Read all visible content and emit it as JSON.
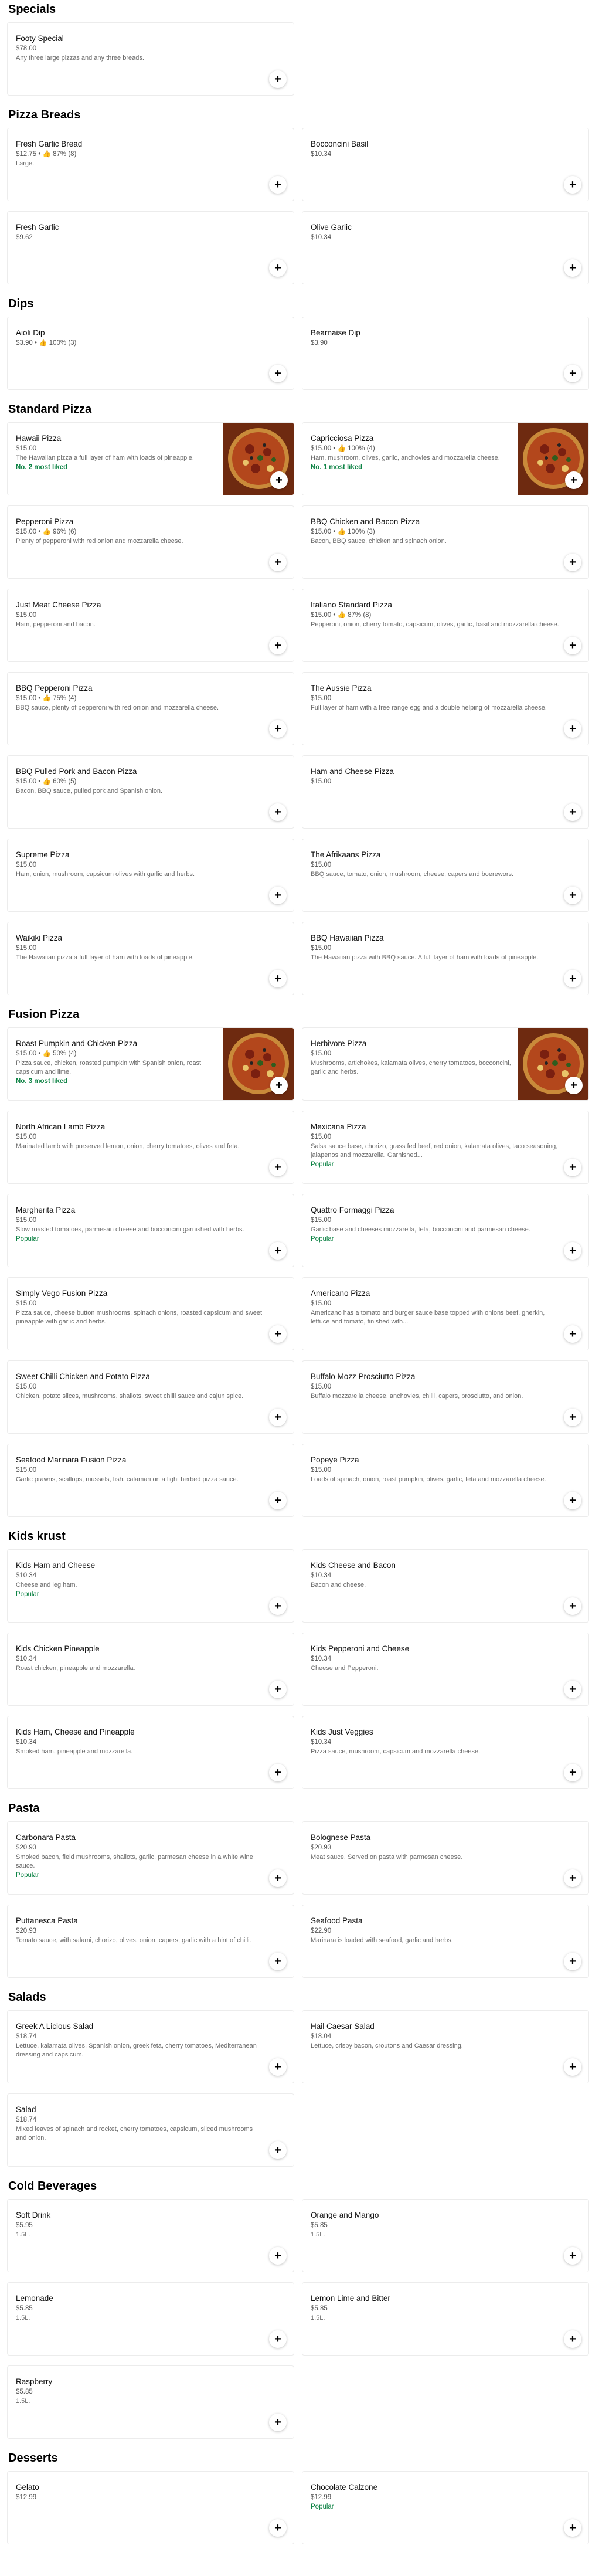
{
  "add_label": "+",
  "sections": [
    {
      "title": "Specials",
      "items": [
        {
          "name": "Footy Special",
          "meta": "$78.00",
          "desc": "Any three large pizzas and any three breads."
        }
      ]
    },
    {
      "title": "Pizza Breads",
      "items": [
        {
          "name": "Fresh Garlic Bread",
          "meta": "$12.75 • 👍 87% (8)",
          "desc": "Large."
        },
        {
          "name": "Bocconcini Basil",
          "meta": "$10.34",
          "desc": ""
        },
        {
          "name": "Fresh Garlic",
          "meta": "$9.62",
          "desc": ""
        },
        {
          "name": "Olive Garlic",
          "meta": "$10.34",
          "desc": ""
        }
      ]
    },
    {
      "title": "Dips",
      "items": [
        {
          "name": "Aioli Dip",
          "meta": "$3.90 • 👍 100% (3)",
          "desc": ""
        },
        {
          "name": "Bearnaise Dip",
          "meta": "$3.90",
          "desc": ""
        }
      ]
    },
    {
      "title": "Standard Pizza",
      "items": [
        {
          "name": "Hawaii Pizza",
          "meta": "$15.00",
          "desc": "The Hawaiian pizza a full layer of ham with loads of pineapple.",
          "tag": "No. 2 most liked",
          "image": "pizza-photo"
        },
        {
          "name": "Capricciosa Pizza",
          "meta": "$15.00 • 👍 100% (4)",
          "desc": "Ham, mushroom, olives, garlic, anchovies and mozzarella cheese.",
          "tag": "No. 1 most liked",
          "image": "pizza-photo"
        },
        {
          "name": "Pepperoni Pizza",
          "meta": "$15.00 • 👍 96% (6)",
          "desc": "Plenty of pepperoni with red onion and mozzarella cheese."
        },
        {
          "name": "BBQ Chicken and Bacon Pizza",
          "meta": "$15.00 • 👍 100% (3)",
          "desc": "Bacon, BBQ sauce, chicken and spinach onion."
        },
        {
          "name": "Just Meat Cheese Pizza",
          "meta": "$15.00",
          "desc": "Ham, pepperoni and bacon."
        },
        {
          "name": "Italiano Standard Pizza",
          "meta": "$15.00 • 👍 87% (8)",
          "desc": "Pepperoni, onion, cherry tomato, capsicum, olives, garlic, basil and mozzarella cheese."
        },
        {
          "name": "BBQ Pepperoni Pizza",
          "meta": "$15.00 • 👍 75% (4)",
          "desc": "BBQ sauce, plenty of pepperoni with red onion and mozzarella cheese."
        },
        {
          "name": "The Aussie Pizza",
          "meta": "$15.00",
          "desc": "Full layer of ham with a free range egg and a double helping of mozzarella cheese."
        },
        {
          "name": "BBQ Pulled Pork and Bacon Pizza",
          "meta": "$15.00 • 👍 60% (5)",
          "desc": "Bacon, BBQ sauce, pulled pork and Spanish onion."
        },
        {
          "name": "Ham and Cheese Pizza",
          "meta": "$15.00",
          "desc": ""
        },
        {
          "name": "Supreme Pizza",
          "meta": "$15.00",
          "desc": "Ham, onion, mushroom, capsicum olives with garlic and herbs."
        },
        {
          "name": "The Afrikaans Pizza",
          "meta": "$15.00",
          "desc": "BBQ sauce, tomato, onion, mushroom, cheese, capers and boerewors."
        },
        {
          "name": "Waikiki Pizza",
          "meta": "$15.00",
          "desc": "The Hawaiian pizza a full layer of ham with loads of pineapple."
        },
        {
          "name": "BBQ Hawaiian Pizza",
          "meta": "$15.00",
          "desc": "The Hawaiian pizza with BBQ sauce. A full layer of ham with loads of pineapple."
        }
      ]
    },
    {
      "title": "Fusion Pizza",
      "items": [
        {
          "name": "Roast Pumpkin and Chicken Pizza",
          "meta": "$15.00 • 👍 50% (4)",
          "desc": "Pizza sauce, chicken, roasted pumpkin with Spanish onion, roast capsicum and lime.",
          "tag": "No. 3 most liked",
          "image": "pizza-photo"
        },
        {
          "name": "Herbivore Pizza",
          "meta": "$15.00",
          "desc": "Mushrooms, artichokes, kalamata olives, cherry tomatoes, bocconcini, garlic and herbs.",
          "image": "pizza-photo"
        },
        {
          "name": "North African Lamb Pizza",
          "meta": "$15.00",
          "desc": "Marinated lamb with preserved lemon, onion, cherry tomatoes, olives and feta."
        },
        {
          "name": "Mexicana Pizza",
          "meta": "$15.00",
          "desc": "Salsa sauce base, chorizo, grass fed beef, red onion, kalamata olives, taco seasoning, jalapenos and mozzarella. Garnished...",
          "tag": "Popular",
          "popular": true
        },
        {
          "name": "Margherita Pizza",
          "meta": "$15.00",
          "desc": "Slow roasted tomatoes, parmesan cheese and bocconcini garnished with herbs.",
          "tag": "Popular",
          "popular": true
        },
        {
          "name": "Quattro Formaggi Pizza",
          "meta": "$15.00",
          "desc": "Garlic base and cheeses mozzarella, feta, bocconcini and parmesan cheese.",
          "tag": "Popular",
          "popular": true
        },
        {
          "name": "Simply Vego Fusion Pizza",
          "meta": "$15.00",
          "desc": "Pizza sauce, cheese button mushrooms, spinach onions, roasted capsicum and sweet pineapple with garlic and herbs."
        },
        {
          "name": "Americano Pizza",
          "meta": "$15.00",
          "desc": "Americano has a tomato and burger sauce base topped with onions beef, gherkin, lettuce and tomato, finished with..."
        },
        {
          "name": "Sweet Chilli Chicken and Potato Pizza",
          "meta": "$15.00",
          "desc": "Chicken, potato slices, mushrooms, shallots, sweet chilli sauce and cajun spice."
        },
        {
          "name": "Buffalo Mozz Prosciutto Pizza",
          "meta": "$15.00",
          "desc": "Buffalo mozzarella cheese, anchovies, chilli, capers, prosciutto, and onion."
        },
        {
          "name": "Seafood Marinara Fusion Pizza",
          "meta": "$15.00",
          "desc": "Garlic prawns, scallops, mussels, fish, calamari on a light herbed pizza sauce."
        },
        {
          "name": "Popeye Pizza",
          "meta": "$15.00",
          "desc": "Loads of spinach, onion, roast pumpkin, olives, garlic, feta and mozzarella cheese."
        }
      ]
    },
    {
      "title": "Kids krust",
      "items": [
        {
          "name": "Kids Ham and Cheese",
          "meta": "$10.34",
          "desc": "Cheese and leg ham.",
          "tag": "Popular",
          "popular": true
        },
        {
          "name": "Kids Cheese and Bacon",
          "meta": "$10.34",
          "desc": "Bacon and cheese."
        },
        {
          "name": "Kids Chicken Pineapple",
          "meta": "$10.34",
          "desc": "Roast chicken, pineapple and mozzarella."
        },
        {
          "name": "Kids Pepperoni and Cheese",
          "meta": "$10.34",
          "desc": "Cheese and Pepperoni."
        },
        {
          "name": "Kids Ham, Cheese and Pineapple",
          "meta": "$10.34",
          "desc": "Smoked ham, pineapple and mozzarella."
        },
        {
          "name": "Kids Just Veggies",
          "meta": "$10.34",
          "desc": "Pizza sauce, mushroom, capsicum and mozzarella cheese."
        }
      ]
    },
    {
      "title": "Pasta",
      "items": [
        {
          "name": "Carbonara Pasta",
          "meta": "$20.93",
          "desc": "Smoked bacon, field mushrooms, shallots, garlic, parmesan cheese in a white wine sauce.",
          "tag": "Popular",
          "popular": true
        },
        {
          "name": "Bolognese Pasta",
          "meta": "$20.93",
          "desc": "Meat sauce. Served on pasta with parmesan cheese."
        },
        {
          "name": "Puttanesca Pasta",
          "meta": "$20.93",
          "desc": "Tomato sauce, with salami, chorizo, olives, onion, capers, garlic with a hint of chilli."
        },
        {
          "name": "Seafood Pasta",
          "meta": "$22.90",
          "desc": "Marinara is loaded with seafood, garlic and herbs."
        }
      ]
    },
    {
      "title": "Salads",
      "items": [
        {
          "name": "Greek A Licious Salad",
          "meta": "$18.74",
          "desc": "Lettuce, kalamata olives, Spanish onion, greek feta, cherry tomatoes, Mediterranean dressing and capsicum."
        },
        {
          "name": "Hail Caesar Salad",
          "meta": "$18.04",
          "desc": "Lettuce, crispy bacon, croutons and Caesar dressing."
        },
        {
          "name": "Salad",
          "meta": "$18.74",
          "desc": "Mixed leaves of spinach and rocket, cherry tomatoes, capsicum, sliced mushrooms and onion."
        }
      ]
    },
    {
      "title": "Cold Beverages",
      "items": [
        {
          "name": "Soft Drink",
          "meta": "$5.95",
          "desc": "1.5L."
        },
        {
          "name": "Orange and Mango",
          "meta": "$5.85",
          "desc": "1.5L."
        },
        {
          "name": "Lemonade",
          "meta": "$5.85",
          "desc": "1.5L."
        },
        {
          "name": "Lemon Lime and Bitter",
          "meta": "$5.85",
          "desc": "1.5L."
        },
        {
          "name": "Raspberry",
          "meta": "$5.85",
          "desc": "1.5L."
        }
      ]
    },
    {
      "title": "Desserts",
      "items": [
        {
          "name": "Gelato",
          "meta": "$12.99",
          "desc": ""
        },
        {
          "name": "Chocolate Calzone",
          "meta": "$12.99",
          "desc": "",
          "tag": "Popular",
          "popular": true
        }
      ]
    }
  ]
}
